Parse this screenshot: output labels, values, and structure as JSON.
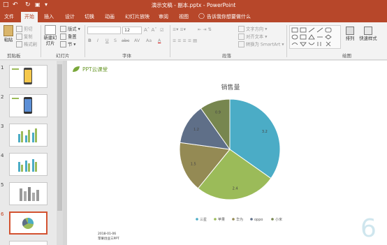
{
  "window": {
    "title": "演示文稿 - 副本.pptx - PowerPoint"
  },
  "quick_access": {
    "save_icon": "save-icon",
    "undo_icon": "undo-icon",
    "redo_icon": "redo-icon",
    "start_icon": "slideshow-icon"
  },
  "tabs": [
    "文件",
    "开始",
    "插入",
    "设计",
    "切换",
    "动画",
    "幻灯片放映",
    "审阅",
    "视图"
  ],
  "tell_me": "告诉我你想要做什么",
  "ribbon": {
    "clipboard": {
      "paste": "粘贴",
      "cut": "剪切",
      "copy": "复制",
      "format_painter": "格式刷",
      "label": "剪贴板"
    },
    "slides": {
      "new_slide": "新建幻灯片",
      "layout": "版式",
      "reset": "重置",
      "section": "节",
      "label": "幻灯片"
    },
    "font": {
      "size": "12",
      "label": "字体",
      "bold": "B",
      "italic": "I",
      "underline": "U",
      "shadow": "S",
      "strike": "abc",
      "spacing": "AV",
      "case": "Aa",
      "color": "A"
    },
    "paragraph": {
      "text_direction": "文字方向",
      "align_text": "对齐文本",
      "smartart": "转换为 SmartArt",
      "label": "段落"
    },
    "drawing": {
      "arrange": "排列",
      "quick_styles": "快速样式",
      "label": "绘图"
    }
  },
  "thumbnails": [
    {
      "num": "1"
    },
    {
      "num": "2"
    },
    {
      "num": "3"
    },
    {
      "num": "4"
    },
    {
      "num": "5"
    },
    {
      "num": "6"
    }
  ],
  "slide": {
    "logo_text": "PPT云课堂",
    "date": "2018-01-06",
    "footer_name": "苹果创业三PPT",
    "page_number": "6"
  },
  "chart_data": {
    "type": "pie",
    "title": "销售量",
    "categories": [
      "三星",
      "苹果",
      "华为",
      "oppo",
      "小米"
    ],
    "values": [
      3.2,
      2.4,
      1.5,
      1.2,
      0.9
    ],
    "colors": [
      "#4bacc6",
      "#9bbb59",
      "#948a54",
      "#5f6f88",
      "#77864f"
    ]
  }
}
